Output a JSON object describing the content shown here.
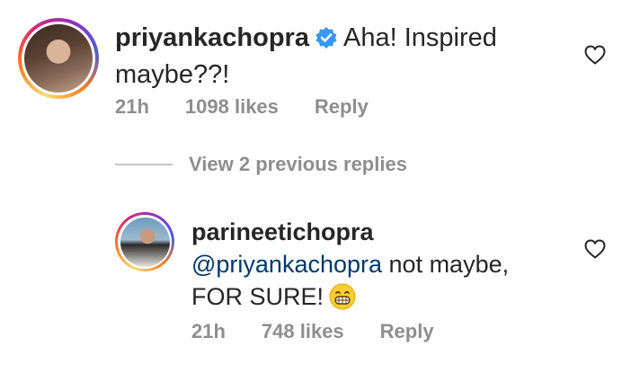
{
  "comment1": {
    "username": "priyankachopra",
    "verified": true,
    "text": "Aha! Inspired",
    "text_line2": "maybe??!",
    "time": "21h",
    "likes": "1098 likes",
    "reply_label": "Reply"
  },
  "view_replies": {
    "label": "View 2 previous replies"
  },
  "comment2": {
    "username": "parineetichopra",
    "mention": "@priyankachopra",
    "text_after_mention": " not maybe,",
    "text_line2": "FOR SURE!",
    "emoji": "grinning-face-emoji",
    "time": "21h",
    "likes": "748 likes",
    "reply_label": "Reply"
  },
  "colors": {
    "verified_blue": "#3897f0",
    "mention_blue": "#00376b",
    "meta_gray": "#8e8e8e"
  }
}
